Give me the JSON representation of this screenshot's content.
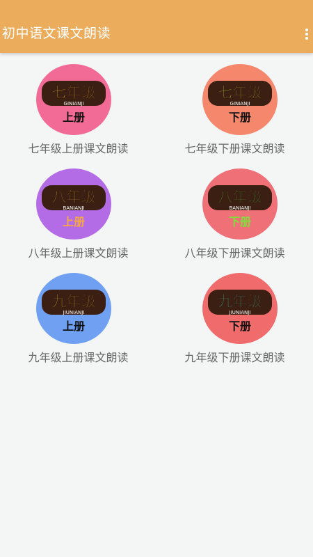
{
  "app": {
    "title": "初中语文课文朗读",
    "menu_icon": "more-vertical-icon",
    "bar_color": "#ebac5c"
  },
  "books": [
    {
      "grade": "七年级",
      "pinyin": "GINIANJI",
      "volume": "上册",
      "label": "七年级上册课文朗读",
      "circle_color": "#f26b96",
      "grade_color": "#f7c42a",
      "volume_color": "#111111"
    },
    {
      "grade": "七年级",
      "pinyin": "GINIANJI",
      "volume": "下册",
      "label": "七年级下册课文朗读",
      "circle_color": "#f5876d",
      "grade_color": "#c6e43a",
      "volume_color": "#111111"
    },
    {
      "grade": "八年级",
      "pinyin": "BANIANJI",
      "volume": "上册",
      "label": "八年级上册课文朗读",
      "circle_color": "#b46be6",
      "grade_color": "#f7c42a",
      "volume_color": "#f7a840"
    },
    {
      "grade": "八年级",
      "pinyin": "BANIANJI",
      "volume": "下册",
      "label": "八年级下册课文朗读",
      "circle_color": "#f07078",
      "grade_color": "#41d83a",
      "volume_color": "#7be23a"
    },
    {
      "grade": "九年级",
      "pinyin": "JIUNIANJI",
      "volume": "上册",
      "label": "九年级上册课文朗读",
      "circle_color": "#6fa0f2",
      "grade_color": "#f7c42a",
      "volume_color": "#111111"
    },
    {
      "grade": "九年级",
      "pinyin": "JIUNIANJI",
      "volume": "下册",
      "label": "九年级下册课文朗读",
      "circle_color": "#f06b6b",
      "grade_color": "#3ae0c8",
      "volume_color": "#111111"
    }
  ]
}
